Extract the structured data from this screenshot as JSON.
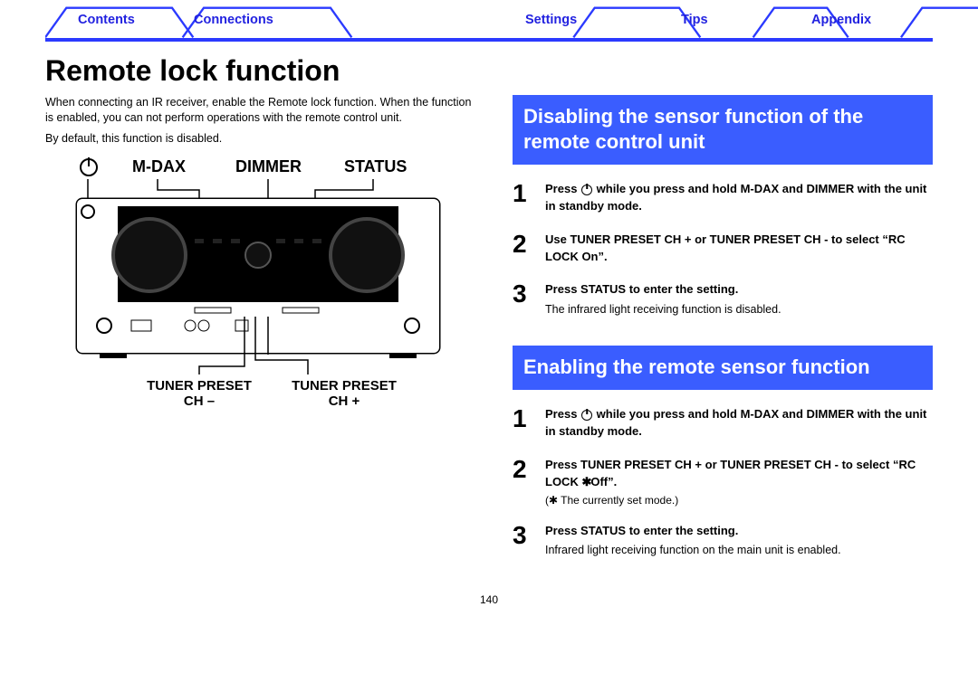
{
  "nav": {
    "contents": "Contents",
    "connections": "Connections",
    "settings": "Settings",
    "tips": "Tips",
    "appendix": "Appendix"
  },
  "page_title": "Remote lock function",
  "intro": {
    "p1": "When connecting an IR receiver, enable the Remote lock function. When the function is enabled, you can not perform operations with the remote control unit.",
    "p2": "By default, this function is disabled."
  },
  "labels": {
    "power": "power",
    "mdax": "M-DAX",
    "dimmer": "DIMMER",
    "status": "STATUS",
    "tuner_ch_minus_l1": "TUNER PRESET",
    "tuner_ch_minus_l2": "CH –",
    "tuner_ch_plus_l1": "TUNER PRESET",
    "tuner_ch_plus_l2": "CH +"
  },
  "section1": {
    "title": "Disabling the sensor function of the remote control unit",
    "steps": [
      {
        "num": "1",
        "bold_before": "Press ",
        "bold_after": " while you press and hold M-DAX and DIMMER with the unit in standby mode."
      },
      {
        "num": "2",
        "bold": "Use TUNER PRESET CH + or TUNER PRESET CH - to select “RC LOCK On”."
      },
      {
        "num": "3",
        "bold": "Press STATUS to enter the setting.",
        "sub": "The infrared light receiving function is disabled."
      }
    ]
  },
  "section2": {
    "title": "Enabling the remote sensor function",
    "steps": [
      {
        "num": "1",
        "bold_before": "Press ",
        "bold_after": " while you press and hold M-DAX and DIMMER with the unit in standby mode."
      },
      {
        "num": "2",
        "bold_a": "Press TUNER PRESET CH + or TUNER PRESET CH - to select “RC LOCK ",
        "bold_b": "Off”.",
        "note": "(✱ The currently set mode.)"
      },
      {
        "num": "3",
        "bold": "Press STATUS to enter the setting.",
        "sub": "Infrared light receiving function on the main unit is enabled."
      }
    ]
  },
  "page_number": "140"
}
